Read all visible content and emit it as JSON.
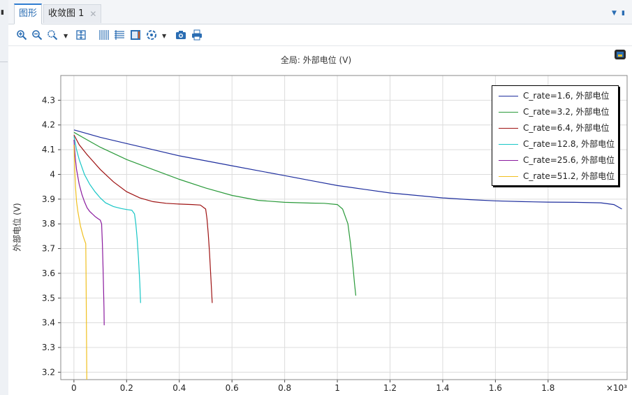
{
  "tabs": [
    {
      "label": "图形"
    },
    {
      "label": "收敛图 1"
    }
  ],
  "toolbar": {
    "icons": [
      "zoom-in-icon",
      "zoom-out-icon",
      "zoom-box-icon",
      "zoom-extents-icon",
      "grid-icon",
      "list-icon",
      "color-table-icon",
      "render-icon",
      "camera-icon",
      "print-icon"
    ]
  },
  "plot": {
    "title": "全局: 外部电位 (V)",
    "ylabel": "外部电位 (V)",
    "x_multiplier": "×10³"
  },
  "colors": {
    "c1_6": "#1f2f9e",
    "c3_2": "#2a9a3a",
    "c6_4": "#9e1212",
    "c12_8": "#18c6c6",
    "c25_6": "#8a1a9e",
    "c51_2": "#f0c020"
  },
  "chart_data": {
    "type": "line",
    "title": "全局: 外部电位 (V)",
    "xlabel": "",
    "ylabel": "外部电位 (V)",
    "xlim": [
      -0.05,
      2.1
    ],
    "ylim": [
      3.17,
      4.4
    ],
    "x_ticks": [
      "0",
      "0.2",
      "0.4",
      "0.6",
      "0.8",
      "1",
      "1.2",
      "1.4",
      "1.6",
      "1.8"
    ],
    "y_ticks": [
      "3.2",
      "3.3",
      "3.4",
      "3.5",
      "3.6",
      "3.7",
      "3.8",
      "3.9",
      "4",
      "4.1",
      "4.2",
      "4.3"
    ],
    "grid": true,
    "legend_position": "top-right",
    "series": [
      {
        "name": "C_rate=1.6, 外部电位",
        "color_key": "c1_6",
        "x": [
          0,
          0.05,
          0.1,
          0.2,
          0.3,
          0.4,
          0.5,
          0.6,
          0.7,
          0.8,
          0.9,
          1.0,
          1.1,
          1.2,
          1.3,
          1.4,
          1.5,
          1.6,
          1.7,
          1.8,
          1.9,
          2.0,
          2.05,
          2.08
        ],
        "y": [
          4.18,
          4.165,
          4.15,
          4.125,
          4.1,
          4.075,
          4.055,
          4.035,
          4.015,
          3.995,
          3.975,
          3.955,
          3.94,
          3.925,
          3.915,
          3.905,
          3.898,
          3.893,
          3.89,
          3.888,
          3.887,
          3.885,
          3.878,
          3.86
        ]
      },
      {
        "name": "C_rate=3.2, 外部电位",
        "color_key": "c3_2",
        "x": [
          0,
          0.05,
          0.1,
          0.2,
          0.3,
          0.4,
          0.5,
          0.6,
          0.7,
          0.8,
          0.9,
          0.95,
          1.0,
          1.02,
          1.04,
          1.05,
          1.06,
          1.065,
          1.07
        ],
        "y": [
          4.17,
          4.14,
          4.11,
          4.06,
          4.02,
          3.98,
          3.945,
          3.915,
          3.895,
          3.887,
          3.884,
          3.883,
          3.878,
          3.86,
          3.8,
          3.72,
          3.62,
          3.56,
          3.51
        ]
      },
      {
        "name": "C_rate=6.4, 外部电位",
        "color_key": "c6_4",
        "x": [
          0,
          0.02,
          0.05,
          0.1,
          0.15,
          0.2,
          0.25,
          0.3,
          0.35,
          0.4,
          0.45,
          0.48,
          0.5,
          0.505,
          0.51,
          0.515,
          0.52,
          0.525
        ],
        "y": [
          4.16,
          4.12,
          4.08,
          4.02,
          3.97,
          3.93,
          3.905,
          3.89,
          3.883,
          3.88,
          3.878,
          3.876,
          3.86,
          3.82,
          3.76,
          3.68,
          3.58,
          3.48
        ]
      },
      {
        "name": "C_rate=12.8, 外部电位",
        "color_key": "c12_8",
        "x": [
          0,
          0.01,
          0.02,
          0.04,
          0.06,
          0.08,
          0.1,
          0.12,
          0.15,
          0.18,
          0.2,
          0.22,
          0.23,
          0.235,
          0.24,
          0.245,
          0.25,
          0.253
        ],
        "y": [
          4.155,
          4.1,
          4.06,
          4.0,
          3.96,
          3.93,
          3.905,
          3.885,
          3.87,
          3.862,
          3.858,
          3.855,
          3.84,
          3.8,
          3.74,
          3.66,
          3.56,
          3.48
        ]
      },
      {
        "name": "C_rate=25.6, 外部电位",
        "color_key": "c25_6",
        "x": [
          0,
          0.005,
          0.01,
          0.02,
          0.03,
          0.04,
          0.05,
          0.06,
          0.07,
          0.08,
          0.09,
          0.1,
          0.105,
          0.108,
          0.11,
          0.112,
          0.114,
          0.115
        ],
        "y": [
          4.14,
          4.07,
          4.02,
          3.96,
          3.92,
          3.89,
          3.865,
          3.85,
          3.84,
          3.83,
          3.822,
          3.815,
          3.8,
          3.72,
          3.64,
          3.56,
          3.46,
          3.39
        ]
      },
      {
        "name": "C_rate=51.2, 外部电位",
        "color_key": "c51_2",
        "x": [
          0,
          0.003,
          0.006,
          0.01,
          0.015,
          0.02,
          0.025,
          0.03,
          0.035,
          0.04,
          0.045,
          0.046,
          0.047,
          0.048,
          0.049
        ],
        "y": [
          4.12,
          4.02,
          3.95,
          3.89,
          3.85,
          3.82,
          3.79,
          3.77,
          3.75,
          3.735,
          3.72,
          3.6,
          3.45,
          3.3,
          3.17
        ]
      }
    ]
  }
}
